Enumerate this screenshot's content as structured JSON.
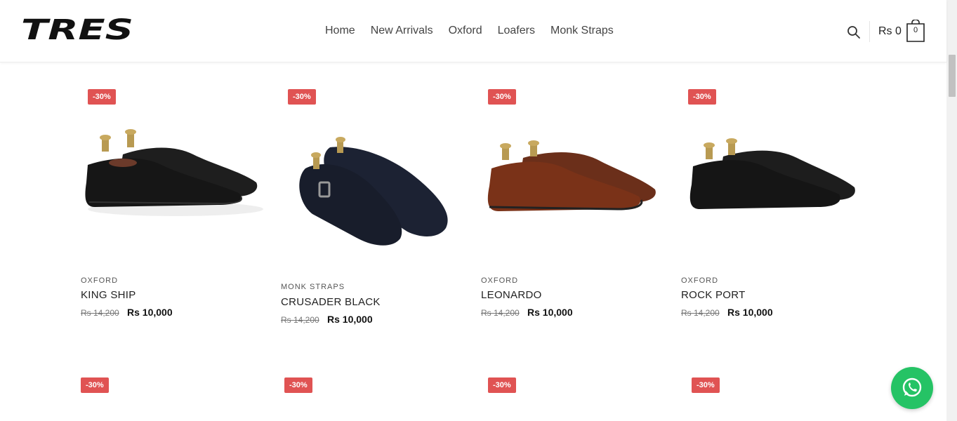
{
  "brand": {
    "logo_text": "TRES"
  },
  "nav": {
    "items": [
      "Home",
      "New Arrivals",
      "Oxford",
      "Loafers",
      "Monk Straps"
    ]
  },
  "cart": {
    "total": "Rs 0",
    "count": "0"
  },
  "colors": {
    "accent": "#e05353",
    "whatsapp": "#25c365"
  },
  "products": [
    {
      "badge": "-30%",
      "category": "OXFORD",
      "name": "KING SHIP",
      "old_price": "Rs 14,200",
      "price": "Rs 10,000"
    },
    {
      "badge": "-30%",
      "category": "MONK STRAPS",
      "name": "CRUSADER BLACK",
      "old_price": "Rs 14,200",
      "price": "Rs 10,000"
    },
    {
      "badge": "-30%",
      "category": "OXFORD",
      "name": "LEONARDO",
      "old_price": "Rs 14,200",
      "price": "Rs 10,000"
    },
    {
      "badge": "-30%",
      "category": "OXFORD",
      "name": "ROCK PORT",
      "old_price": "Rs 14,200",
      "price": "Rs 10,000"
    }
  ],
  "next_row_badges": [
    "-30%",
    "-30%",
    "-30%",
    "-30%"
  ]
}
